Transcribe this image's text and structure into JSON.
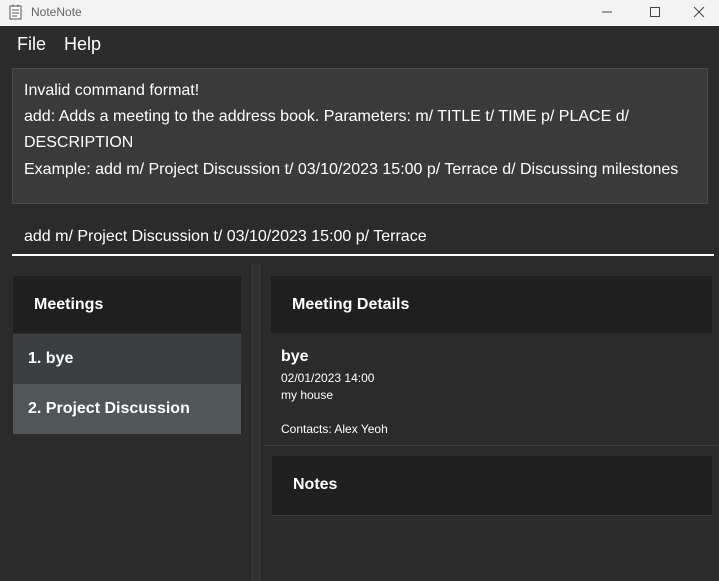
{
  "window": {
    "title": "NoteNote",
    "app_icon": "notepad-icon",
    "controls": [
      "minimize-icon",
      "maximize-icon",
      "close-icon"
    ]
  },
  "menu": {
    "items": [
      {
        "label": "File"
      },
      {
        "label": "Help"
      }
    ]
  },
  "result": {
    "lines": [
      "Invalid command format!",
      "add: Adds a meeting to the address book. Parameters: m/ TITLE t/ TIME p/ PLACE d/",
      "DESCRIPTION",
      "Example: add m/ Project Discussion t/ 03/10/2023 15:00 p/ Terrace d/ Discussing milestones"
    ]
  },
  "command": {
    "value": "add m/ Project Discussion t/ 03/10/2023 15:00 p/ Terrace"
  },
  "meetings": {
    "header": "Meetings",
    "items": [
      {
        "label": "1.  bye"
      },
      {
        "label": "2.  Project Discussion"
      }
    ]
  },
  "details": {
    "header": "Meeting Details",
    "title": "bye",
    "time": "02/01/2023 14:00",
    "place": "my house",
    "contacts": "Contacts: Alex Yeoh"
  },
  "notes": {
    "header": "Notes"
  },
  "colors": {
    "background": "#2b2b2b",
    "header_bg": "#1f1f1f",
    "selected_item": "#515658",
    "text": "#ffffff"
  }
}
